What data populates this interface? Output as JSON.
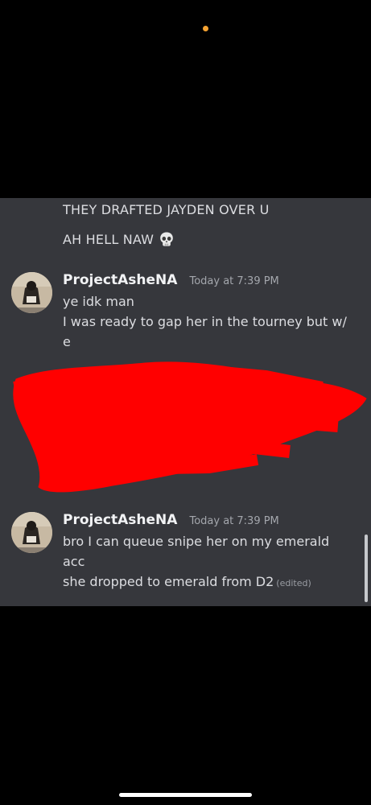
{
  "status_bar": {
    "indicator_color": "#f5a332"
  },
  "prior_messages": [
    {
      "text": "THEY DRAFTED JAYDEN OVER U"
    },
    {
      "text": "AH HELL NAW",
      "emoji": "skull-emoji"
    }
  ],
  "messages": [
    {
      "username": "ProjectAsheNA",
      "timestamp": "Today at 7:39 PM",
      "lines": [
        "ye idk man",
        "I was ready to gap her in the tourney but w/",
        "e"
      ]
    },
    {
      "username": "ProjectAsheNA",
      "timestamp": "Today at 7:39 PM",
      "lines": [
        "bro I can queue snipe her on my emerald",
        "acc",
        "she dropped to emerald from D2"
      ],
      "edited_label": "(edited)"
    }
  ],
  "redaction": {
    "color": "#ff0000"
  }
}
